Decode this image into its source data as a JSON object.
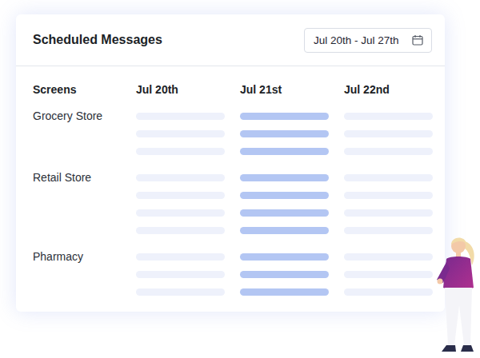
{
  "title": "Scheduled Messages",
  "date_range": {
    "label": "Jul 20th - Jul 27th"
  },
  "table": {
    "header": "Screens",
    "days": [
      {
        "label": "Jul 20th",
        "selected": false
      },
      {
        "label": "Jul 21st",
        "selected": true
      },
      {
        "label": "Jul 22nd",
        "selected": false
      }
    ],
    "screens": [
      {
        "name": "Grocery Store",
        "messages": 3
      },
      {
        "name": "Retail Store",
        "messages": 4
      },
      {
        "name": "Pharmacy",
        "messages": 3
      }
    ]
  }
}
